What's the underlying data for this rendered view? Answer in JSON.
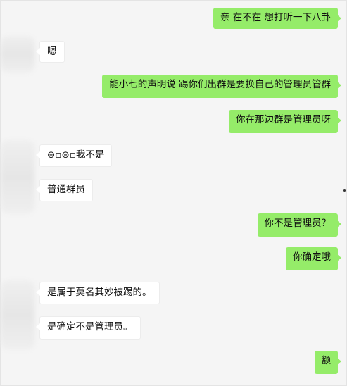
{
  "chat": {
    "messages": [
      {
        "side": "out",
        "text": "亲 在不在 想打听一下八卦"
      },
      {
        "side": "in",
        "text": "嗯"
      },
      {
        "side": "out",
        "text": "能小七的声明说 踢你们出群是要换自己的管理员管群"
      },
      {
        "side": "out",
        "text": "你在那边群是管理员呀"
      },
      {
        "side": "in",
        "text": "⊝▫⊝▫我不是"
      },
      {
        "side": "in",
        "text": "普通群员"
      },
      {
        "side": "out",
        "text": "你不是管理员？"
      },
      {
        "side": "out",
        "text": "你确定哦"
      },
      {
        "side": "in",
        "text": "是属于莫名其妙被踢的。"
      },
      {
        "side": "in",
        "text": "是确定不是管理员。"
      },
      {
        "side": "out",
        "text": "额"
      }
    ]
  },
  "colors": {
    "outgoing_bubble": "#95ec69",
    "incoming_bubble": "#ffffff",
    "background": "#f5f5f5"
  }
}
